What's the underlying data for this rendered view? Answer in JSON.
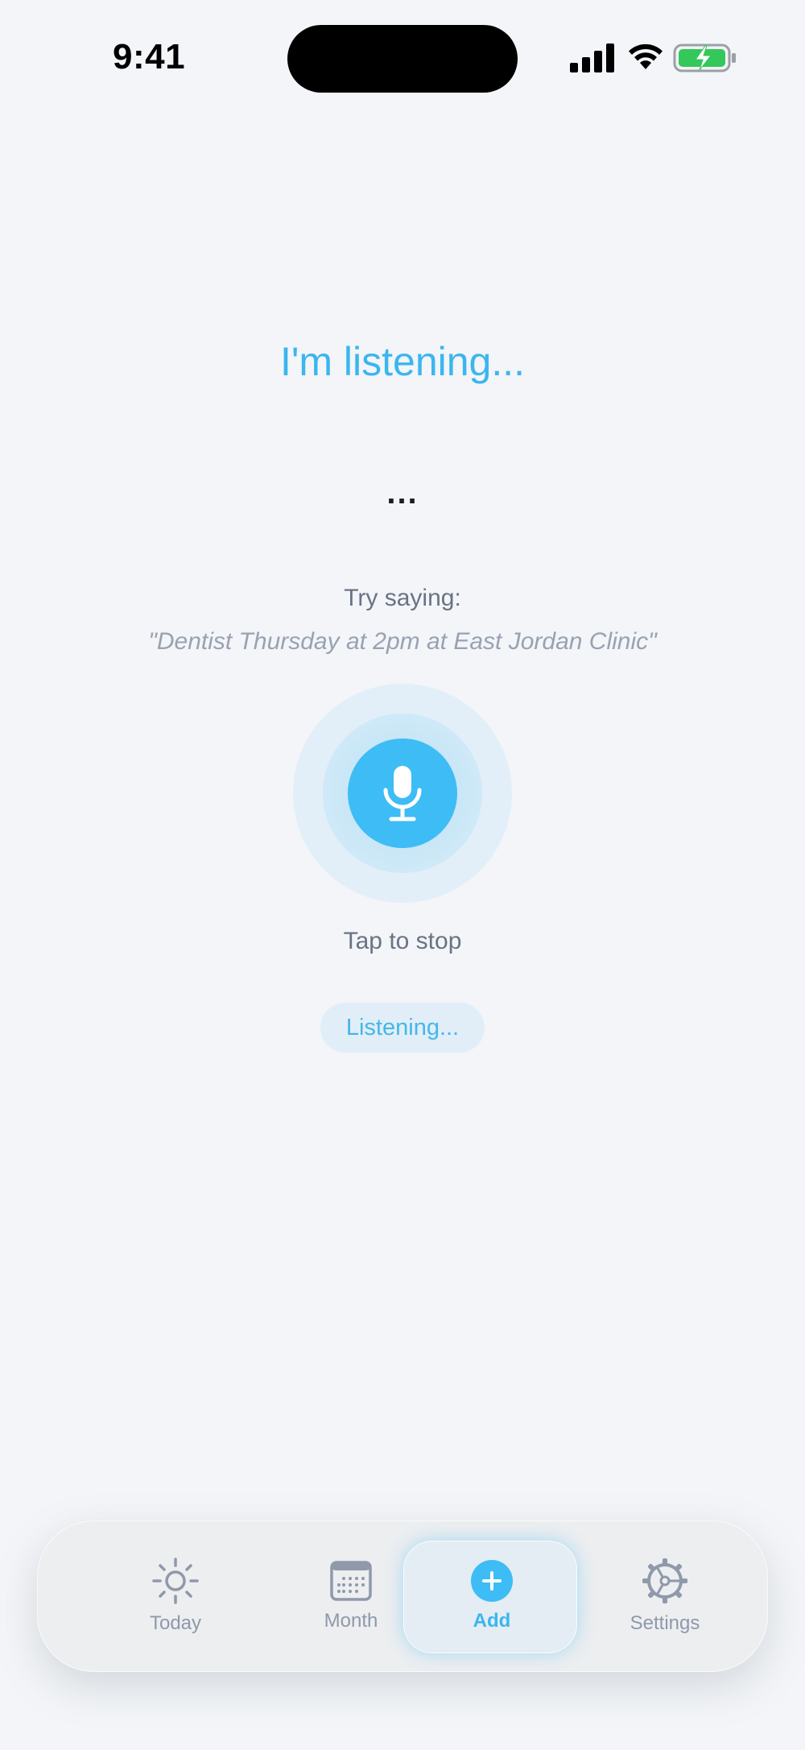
{
  "status_bar": {
    "time": "9:41"
  },
  "main": {
    "title": "I'm listening...",
    "transcript": "...",
    "hint_label": "Try saying:",
    "hint_example": "\"Dentist Thursday at 2pm at East Jordan Clinic\"",
    "mic_action": "Tap to stop",
    "status_pill": "Listening..."
  },
  "tabbar": {
    "items": [
      {
        "label": "Today",
        "icon": "sun-icon"
      },
      {
        "label": "Month",
        "icon": "calendar-icon"
      },
      {
        "label": "Add",
        "icon": "plus-circle-icon",
        "active": true
      },
      {
        "label": "Settings",
        "icon": "gear-icon"
      }
    ]
  },
  "colors": {
    "accent": "#3ebcf5",
    "text_secondary": "#687385",
    "background": "#f3f5f8"
  }
}
